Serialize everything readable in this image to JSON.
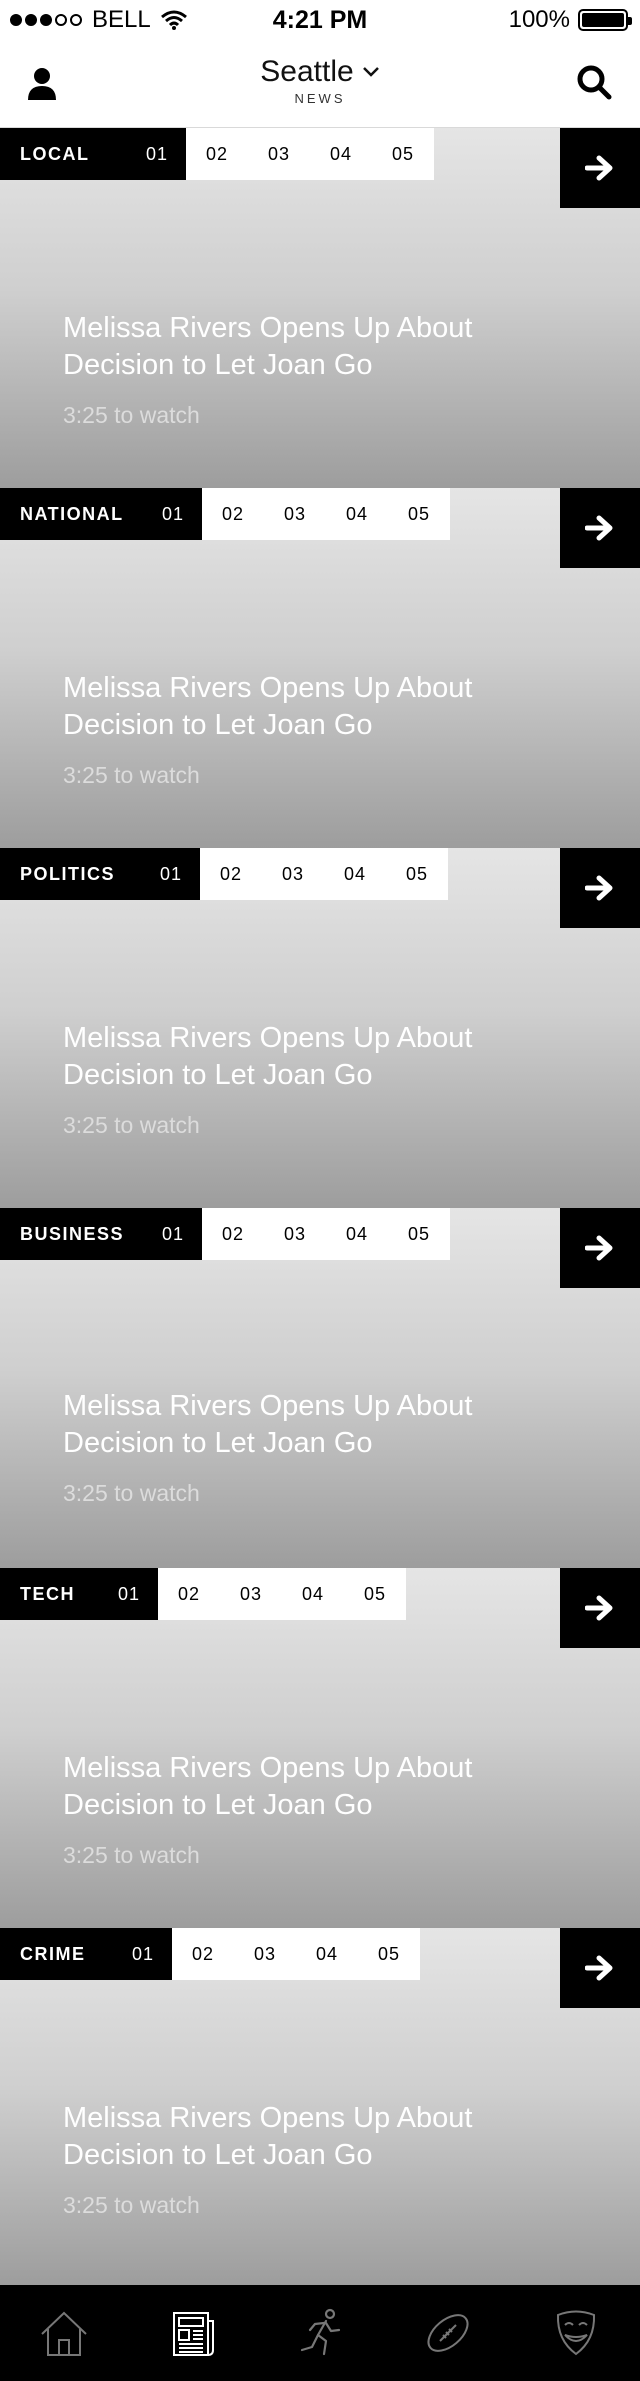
{
  "status_bar": {
    "carrier": "BELL",
    "time": "4:21 PM",
    "battery": "100%"
  },
  "nav": {
    "city": "Seattle",
    "section": "NEWS"
  },
  "sections": [
    {
      "category": "LOCAL",
      "pages": [
        "01",
        "02",
        "03",
        "04",
        "05"
      ],
      "active_page": "01",
      "headline": "Melissa Rivers Opens Up About Decision to Let Joan Go",
      "duration": "3:25 to watch"
    },
    {
      "category": "NATIONAL",
      "pages": [
        "01",
        "02",
        "03",
        "04",
        "05"
      ],
      "active_page": "01",
      "headline": "Melissa Rivers Opens Up About Decision to Let Joan Go",
      "duration": "3:25 to watch"
    },
    {
      "category": "POLITICS",
      "pages": [
        "01",
        "02",
        "03",
        "04",
        "05"
      ],
      "active_page": "01",
      "headline": "Melissa Rivers Opens Up About Decision to Let Joan Go",
      "duration": "3:25 to watch"
    },
    {
      "category": "BUSINESS",
      "pages": [
        "01",
        "02",
        "03",
        "04",
        "05"
      ],
      "active_page": "01",
      "headline": "Melissa Rivers Opens Up About Decision to Let Joan Go",
      "duration": "3:25 to watch"
    },
    {
      "category": "TECH",
      "pages": [
        "01",
        "02",
        "03",
        "04",
        "05"
      ],
      "active_page": "01",
      "headline": "Melissa Rivers Opens Up About Decision to Let Joan Go",
      "duration": "3:25 to watch"
    },
    {
      "category": "CRIME",
      "pages": [
        "01",
        "02",
        "03",
        "04",
        "05"
      ],
      "active_page": "01",
      "headline": "Melissa Rivers Opens Up About Decision to Let Joan Go",
      "duration": "3:25 to watch"
    }
  ],
  "tabbar": {
    "items": [
      {
        "icon": "home-icon",
        "active": false
      },
      {
        "icon": "newspaper-icon",
        "active": true
      },
      {
        "icon": "runner-icon",
        "active": false
      },
      {
        "icon": "football-icon",
        "active": false
      },
      {
        "icon": "theater-mask-icon",
        "active": false
      }
    ]
  },
  "colors": {
    "bar": "#000000",
    "tab_inactive": "#ffffff",
    "tab_icon_inactive": "#777777",
    "tab_icon_active": "#ffffff"
  }
}
